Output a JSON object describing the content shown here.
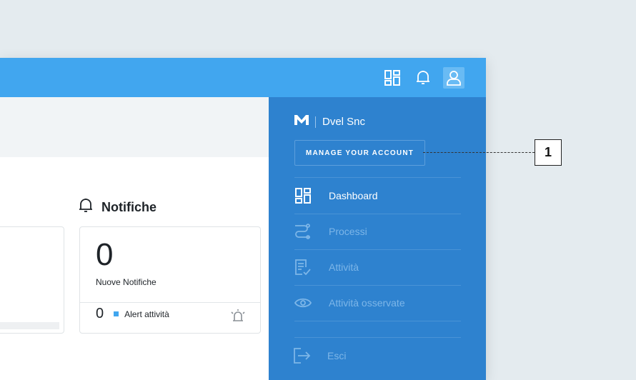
{
  "topbar": {
    "icons": [
      "dashboard-grid-icon",
      "bell-icon",
      "user-icon"
    ],
    "accent": "#41a6ef"
  },
  "notifications": {
    "title": "Notifiche",
    "count": "0",
    "count_label": "Nuove Notifiche",
    "alert_count": "0",
    "alert_label": "Alert attività"
  },
  "panel": {
    "background": "#2e82cf",
    "company_name": "Dvel Snc",
    "manage_account_label": "MANAGE YOUR ACCOUNT",
    "nav": [
      {
        "label": "Dashboard",
        "icon": "dashboard-icon",
        "active": true
      },
      {
        "label": "Processi",
        "icon": "processes-icon",
        "active": false
      },
      {
        "label": "Attività",
        "icon": "activity-checklist-icon",
        "active": false
      },
      {
        "label": "Attività osservate",
        "icon": "eye-icon",
        "active": false
      }
    ],
    "logout_label": "Esci"
  },
  "callout": {
    "number": "1"
  }
}
